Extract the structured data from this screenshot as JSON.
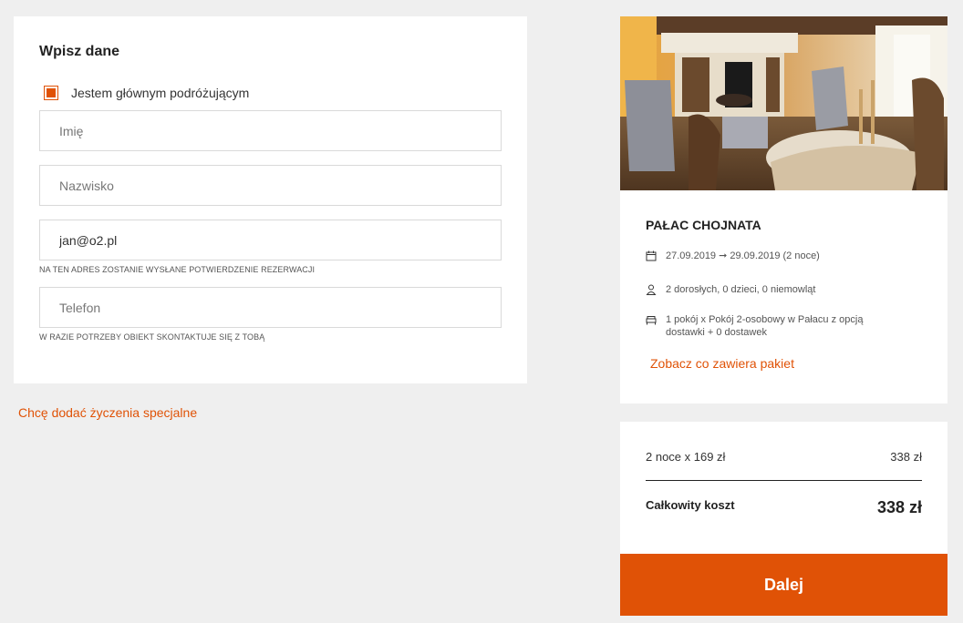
{
  "form": {
    "title": "Wpisz dane",
    "main_traveler_label": "Jestem głównym podróżującym",
    "main_traveler_checked": true,
    "first_name": {
      "placeholder": "Imię",
      "value": ""
    },
    "last_name": {
      "placeholder": "Nazwisko",
      "value": ""
    },
    "email": {
      "placeholder": "",
      "value": "jan@o2.pl",
      "hint": "NA TEN ADRES ZOSTANIE WYSŁANE POTWIERDZENIE REZERWACJI"
    },
    "phone": {
      "placeholder": "Telefon",
      "value": "",
      "hint": "W RAZIE POTRZEBY OBIEKT SKONTAKTUJE SIĘ Z TOBĄ"
    }
  },
  "special_requests_link": "Chcę dodać życzenia specjalne",
  "hotel": {
    "name": "PAŁAC CHOJNATA",
    "dates": "27.09.2019 ➞ 29.09.2019 (2 noce)",
    "guests": "2 dorosłych, 0 dzieci, 0 niemowląt",
    "room_line1": "1 pokój x Pokój 2-osobowy w Pałacu z opcją",
    "room_line2": "dostawki + 0 dostawek",
    "package_link": "Zobacz co zawiera pakiet",
    "icons": {
      "dates": "calendar-icon",
      "guests": "person-icon",
      "room": "bed-icon"
    }
  },
  "price": {
    "nights_label": "2 noce x 169 zł",
    "nights_value": "338 zł",
    "total_label": "Całkowity koszt",
    "total_value": "338 zł"
  },
  "next_button_label": "Dalej",
  "colors": {
    "accent": "#e05206",
    "background": "#efefef"
  }
}
